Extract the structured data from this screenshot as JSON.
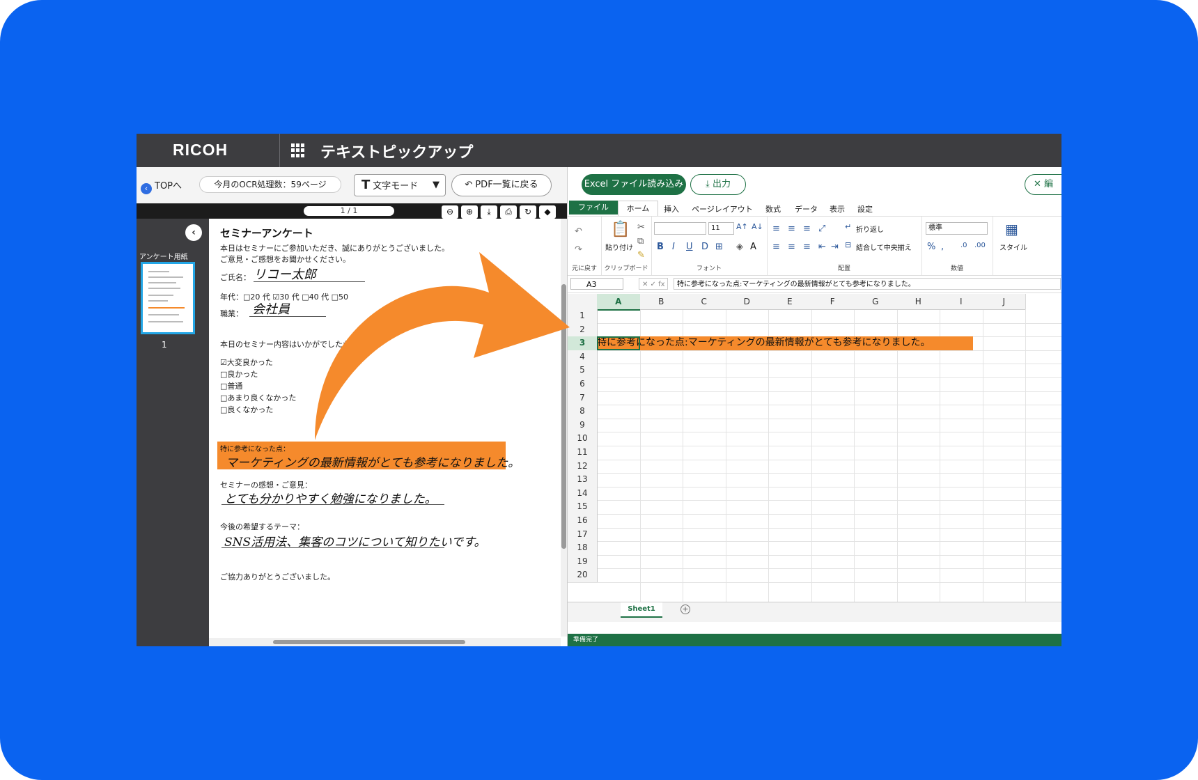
{
  "app": {
    "logo": "RICOH",
    "title": "テキストピックアップ"
  },
  "left_toolbar": {
    "top_link": "TOPへ",
    "ocr_count": "今月のOCR処理数：59ページ",
    "mode_label": "文字モード",
    "mode_icon": "T",
    "back_label": "PDF一覧に戻る"
  },
  "viewer": {
    "page_indicator": "1 / 1",
    "thumbnail_label": "アンケート用紙",
    "thumbnail_number": "1"
  },
  "document": {
    "title": "セミナーアンケート",
    "intro1": "本日はセミナーにご参加いただき、誠にありがとうございました。",
    "intro2": "ご意見・ご感想をお聞かせください。",
    "name_label": "ご氏名：",
    "name_value": "リコー太郎",
    "age_label": "年代：□20 代  ☑30 代  □40 代  □50",
    "job_label": "職業：",
    "job_value": "会社員",
    "question": "本日のセミナー内容はいかがでしたか？",
    "options": [
      "☑大変良かった",
      "□良かった",
      "□普通",
      "□あまり良くなかった",
      "□良くなかった"
    ],
    "ref_label": "特に参考になった点：",
    "ref_value": "マーケティングの最新情報がとても参考になりました。",
    "impression_label": "セミナーの感想・ご意見：",
    "impression_value": "とても分かりやすく勉強になりました。",
    "theme_label": "今後の希望するテーマ：",
    "theme_value": "SNS活用法、集客のコツについて知りたいです。",
    "closing": "ご協力ありがとうございました。"
  },
  "right_toolbar": {
    "excel_import": "Excel ファイル読み込み",
    "output": "出力",
    "edit": "編"
  },
  "excel": {
    "tabs": [
      "ファイル",
      "ホーム",
      "挿入",
      "ページレイアウト",
      "数式",
      "データ",
      "表示",
      "設定"
    ],
    "ribbon": {
      "undo_group": "元に戻す",
      "paste": "貼り付け",
      "clipboard": "クリップボード",
      "font_size": "11",
      "font_group": "フォント",
      "wrap": "折り返し",
      "merge": "結合して中央揃え",
      "align_group": "配置",
      "number_format": "標準",
      "number_group": "数値",
      "style": "スタイル"
    },
    "name_box": "A3",
    "formula": "特に参考になった点:マーケティングの最新情報がとても参考になりました。",
    "columns": [
      "A",
      "B",
      "C",
      "D",
      "E",
      "F",
      "G",
      "H",
      "I",
      "J"
    ],
    "rows": [
      "1",
      "2",
      "3",
      "4",
      "5",
      "6",
      "7",
      "8",
      "9",
      "10",
      "11",
      "12",
      "13",
      "14",
      "15",
      "16",
      "17",
      "18",
      "19",
      "20"
    ],
    "cell_a3": "特に参考になった点:マーケティングの最新情報がとても参考になりました。",
    "sheet_tab": "Sheet1",
    "status": "準備完了"
  },
  "colors": {
    "background": "#0a63f0",
    "accent_orange": "#f58a2c",
    "excel_green": "#1e7145",
    "topbar": "#3d3d40"
  }
}
